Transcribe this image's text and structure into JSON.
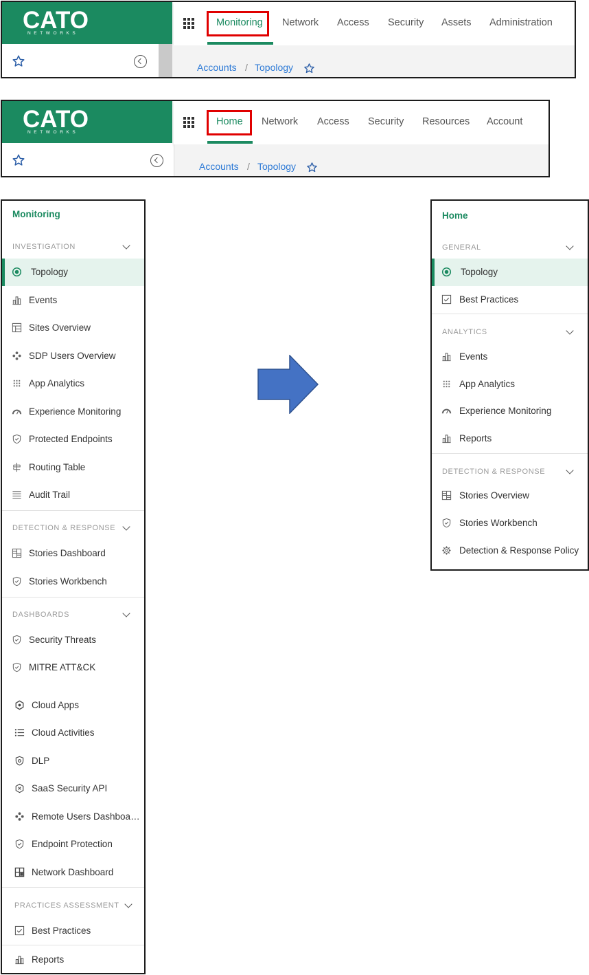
{
  "header_before": {
    "logo_text": "CATO",
    "logo_sub": "NETWORKS",
    "nav": [
      "Monitoring",
      "Network",
      "Access",
      "Security",
      "Assets",
      "Administration"
    ],
    "active": "Monitoring",
    "breadcrumb": [
      "Accounts",
      "/",
      "Topology"
    ]
  },
  "header_after": {
    "logo_text": "CATO",
    "logo_sub": "NETWORKS",
    "nav": [
      "Home",
      "Network",
      "Access",
      "Security",
      "Resources",
      "Account"
    ],
    "active": "Home",
    "breadcrumb": [
      "Accounts",
      "/",
      "Topology"
    ]
  },
  "sidebar_before": {
    "title": "Monitoring",
    "sections": [
      {
        "label": "INVESTIGATION",
        "items": [
          {
            "label": "Topology",
            "icon": "topology-icon",
            "active": true
          },
          {
            "label": "Events",
            "icon": "bar-chart-icon"
          },
          {
            "label": "Sites Overview",
            "icon": "layout-icon"
          },
          {
            "label": "SDP Users Overview",
            "icon": "users-icon"
          },
          {
            "label": "App Analytics",
            "icon": "dots-grid-icon"
          },
          {
            "label": "Experience Monitoring",
            "icon": "gauge-icon"
          },
          {
            "label": "Protected Endpoints",
            "icon": "shield-icon"
          },
          {
            "label": "Routing Table",
            "icon": "routing-icon"
          },
          {
            "label": "Audit Trail",
            "icon": "list-lines-icon"
          }
        ]
      },
      {
        "label": "DETECTION & RESPONSE",
        "items": [
          {
            "label": "Stories Dashboard",
            "icon": "dashboard-icon"
          },
          {
            "label": "Stories Workbench",
            "icon": "shield-icon"
          }
        ]
      },
      {
        "label": "DASHBOARDS",
        "items": [
          {
            "label": "Security Threats",
            "icon": "shield-icon"
          },
          {
            "label": "MITRE ATT&CK",
            "icon": "shield-icon"
          },
          {
            "label": "Cloud Apps",
            "icon": "hexagon-icon"
          },
          {
            "label": "Cloud Activities",
            "icon": "bullet-list-icon"
          },
          {
            "label": "DLP",
            "icon": "shield-lock-icon"
          },
          {
            "label": "SaaS Security API",
            "icon": "hex-x-icon"
          },
          {
            "label": "Remote Users Dashboa…",
            "icon": "users-icon"
          },
          {
            "label": "Endpoint Protection",
            "icon": "shield-icon"
          },
          {
            "label": "Network Dashboard",
            "icon": "dashboard-icon"
          }
        ]
      },
      {
        "label": "PRACTICES ASSESSMENT",
        "items": [
          {
            "label": "Best Practices",
            "icon": "checkbox-icon"
          }
        ]
      }
    ],
    "footer_item": {
      "label": "Reports",
      "icon": "bar-chart-icon"
    }
  },
  "sidebar_after": {
    "title": "Home",
    "sections": [
      {
        "label": "GENERAL",
        "items": [
          {
            "label": "Topology",
            "icon": "topology-icon",
            "active": true
          },
          {
            "label": "Best Practices",
            "icon": "checkbox-icon"
          }
        ]
      },
      {
        "label": "ANALYTICS",
        "items": [
          {
            "label": "Events",
            "icon": "bar-chart-icon"
          },
          {
            "label": "App Analytics",
            "icon": "dots-grid-icon"
          },
          {
            "label": "Experience Monitoring",
            "icon": "gauge-icon"
          },
          {
            "label": "Reports",
            "icon": "bar-chart-icon"
          }
        ]
      },
      {
        "label": "DETECTION & RESPONSE",
        "items": [
          {
            "label": "Stories Overview",
            "icon": "dashboard-icon"
          },
          {
            "label": "Stories Workbench",
            "icon": "shield-icon"
          },
          {
            "label": "Detection & Response Policy",
            "icon": "gear-icon"
          }
        ]
      }
    ]
  },
  "colors": {
    "brand": "#1b8a60",
    "highlight": "#e00000",
    "link": "#2d7ad6",
    "arrow": "#4472c4"
  }
}
